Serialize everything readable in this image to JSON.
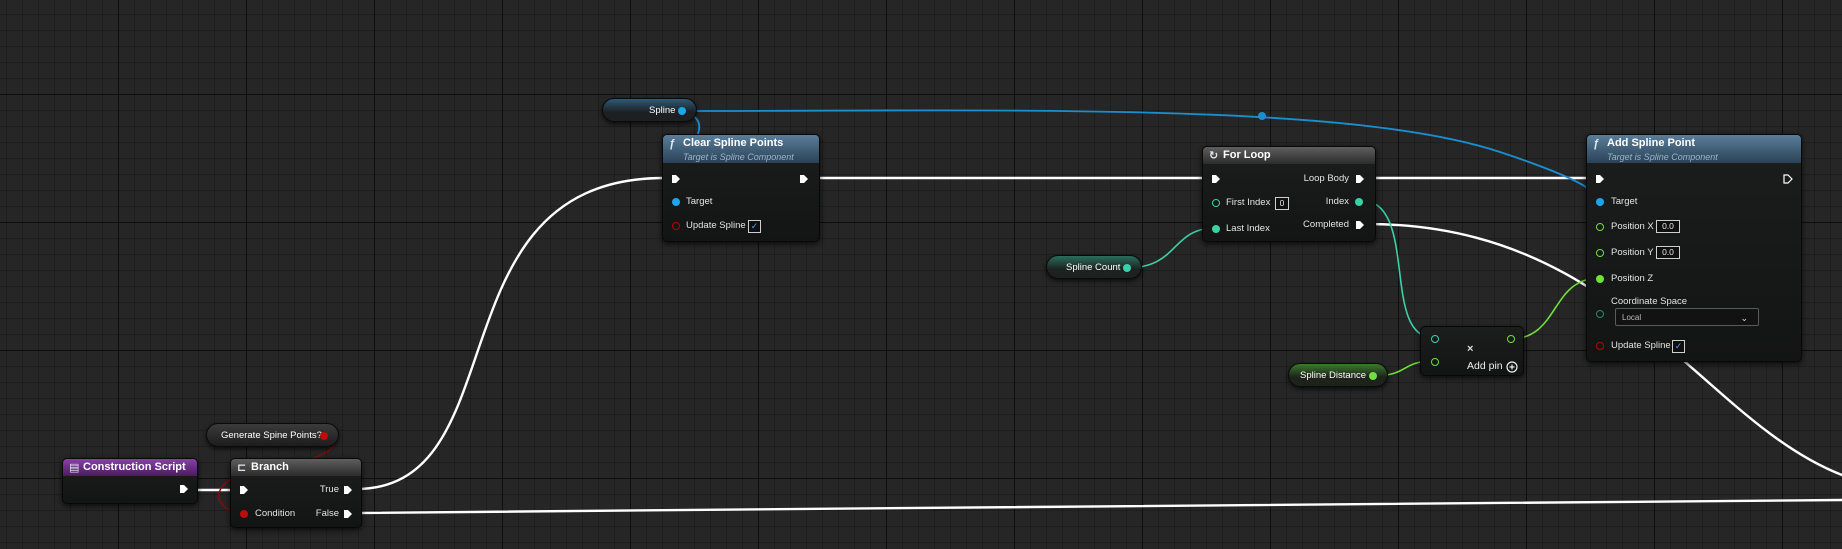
{
  "colors": {
    "exec": "#ffffff",
    "object": "#1aa6e8",
    "integer": "#3ad1a8",
    "float": "#6fe03a",
    "boolean": "#c10a0a"
  },
  "nodes": {
    "construction_script": {
      "title": "Construction Script"
    },
    "branch": {
      "title": "Branch",
      "pin_true": "True",
      "pin_false": "False",
      "pin_condition": "Condition"
    },
    "generate_var": {
      "label": "Generate Spine Points?"
    },
    "spline_var": {
      "label": "Spline"
    },
    "clear_spline_points": {
      "title": "Clear Spline Points",
      "subtitle": "Target is Spline Component",
      "pin_target": "Target",
      "pin_update": "Update Spline",
      "update_checked": "✓"
    },
    "for_loop": {
      "title": "For Loop",
      "pin_first": "First Index",
      "first_value": "0",
      "pin_last": "Last Index",
      "pin_body": "Loop Body",
      "pin_index": "Index",
      "pin_completed": "Completed"
    },
    "spline_count_var": {
      "label": "Spline Count"
    },
    "spline_distance_var": {
      "label": "Spline Distance"
    },
    "multiply": {
      "symbol": "×",
      "add_pin": "Add pin"
    },
    "add_spline_point": {
      "title": "Add Spline Point",
      "subtitle": "Target is Spline Component",
      "pin_target": "Target",
      "pin_x": "Position X",
      "x_value": "0.0",
      "pin_y": "Position Y",
      "y_value": "0.0",
      "pin_z": "Position Z",
      "coord_space_label": "Coordinate Space",
      "coord_space_value": "Local",
      "pin_update": "Update Spline",
      "update_checked": "✓"
    }
  },
  "icons": {
    "function": "function-icon",
    "loop": "loop-icon",
    "branch": "branch-icon",
    "event": "event-icon",
    "dropdown": "chevron-down-icon",
    "add": "add-pin-icon"
  }
}
